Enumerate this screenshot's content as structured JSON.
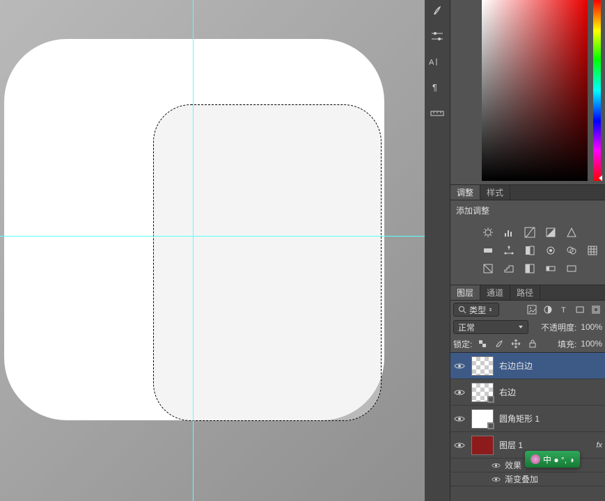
{
  "adjust_tabs": {
    "adjust": "调整",
    "style": "样式"
  },
  "adjust_title": "添加调整",
  "layers_tabs": {
    "layers": "图层",
    "channels": "通道",
    "paths": "路径"
  },
  "type_filter": "类型",
  "blend_mode": "正常",
  "opacity_label": "不透明度:",
  "opacity_value": "100%",
  "lock_label": "锁定:",
  "fill_label": "填充:",
  "fill_value": "100%",
  "layers": [
    {
      "name": "右边白边",
      "selected": true,
      "thumb": "check"
    },
    {
      "name": "右边",
      "selected": false,
      "thumb": "check"
    },
    {
      "name": "圆角矩形 1",
      "selected": false,
      "thumb": "round"
    },
    {
      "name": "图层 1",
      "selected": false,
      "thumb": "red",
      "has_fx": true
    }
  ],
  "effects": {
    "title": "效果",
    "gradient_overlay": "渐变叠加"
  },
  "ime": "中 ● °, ◑"
}
